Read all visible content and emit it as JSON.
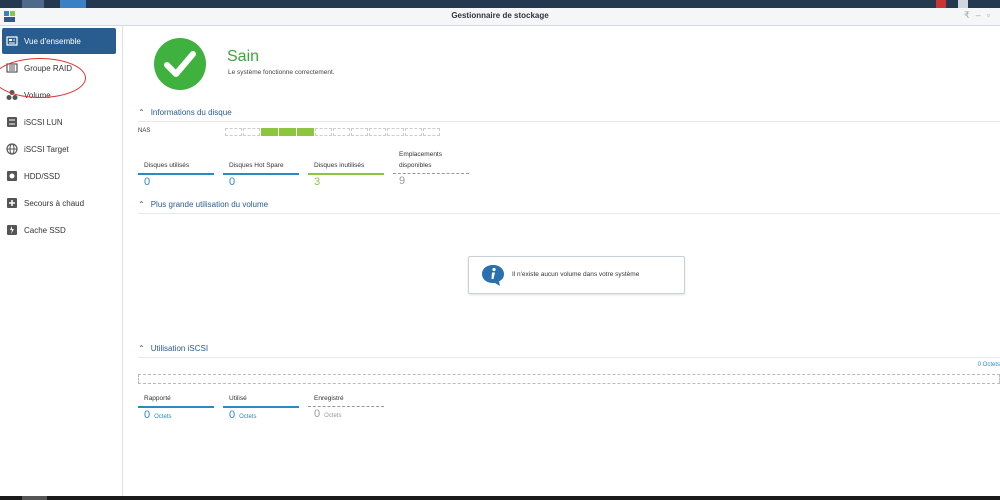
{
  "window": {
    "title": "Gestionnaire de stockage"
  },
  "sidebar": {
    "items": [
      {
        "label": "Vue d'ensemble",
        "active": true
      },
      {
        "label": "Groupe RAID"
      },
      {
        "label": "Volume"
      },
      {
        "label": "iSCSI LUN"
      },
      {
        "label": "iSCSI Target"
      },
      {
        "label": "HDD/SSD"
      },
      {
        "label": "Secours à chaud"
      },
      {
        "label": "Cache SSD"
      }
    ]
  },
  "status": {
    "title": "Sain",
    "subtitle": "Le système fonctionne correctement.",
    "color": "#3fb13f"
  },
  "disk_info": {
    "header": "Informations du disque",
    "nas_label": "NAS",
    "slots_total": 12,
    "slots_used": [
      3,
      4,
      5
    ],
    "stats": [
      {
        "label": "Disques utilisés",
        "value": "0",
        "color": "#2a8ac6"
      },
      {
        "label": "Disques Hot Spare",
        "value": "0",
        "color": "#2a8ac6"
      },
      {
        "label": "Disques inutilisés",
        "value": "3",
        "color": "#8cc63f"
      },
      {
        "label_line1": "Emplacements",
        "label_line2": "disponibles",
        "value": "9",
        "color": "#999999"
      }
    ]
  },
  "volume_usage": {
    "header": "Plus grande utilisation du volume",
    "empty_message": "Il n'existe aucun volume dans votre système"
  },
  "iscsi": {
    "header": "Utilisation iSCSI",
    "total": "0 Octets",
    "stats": [
      {
        "label": "Rapporté",
        "value": "0",
        "unit": "Octets",
        "color": "#2a8ac6"
      },
      {
        "label": "Utilisé",
        "value": "0",
        "unit": "Octets",
        "color": "#2a8ac6"
      },
      {
        "label": "Enregistré",
        "value": "0",
        "unit": "Octets",
        "color": "#999999"
      }
    ]
  }
}
